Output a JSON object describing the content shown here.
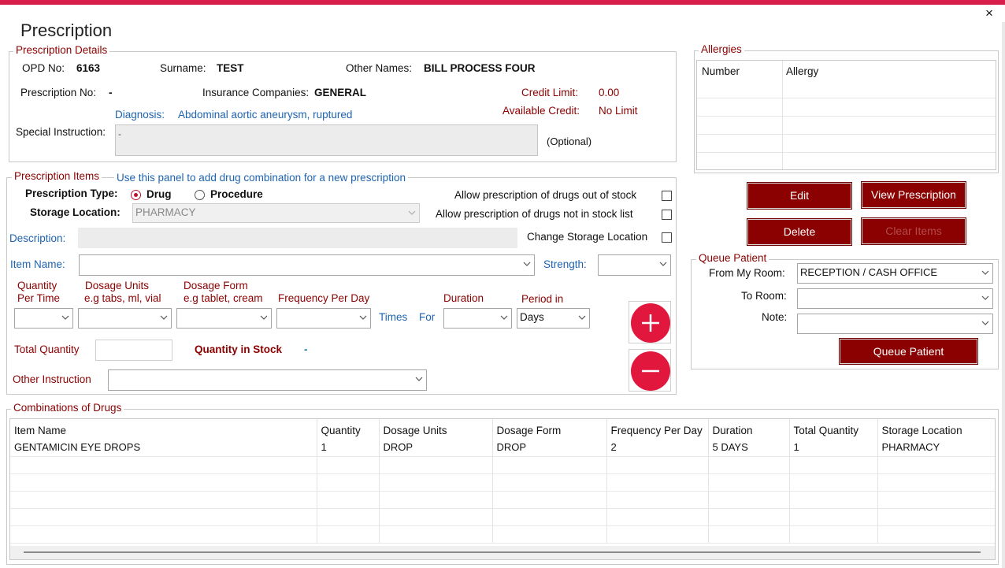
{
  "title": "Prescription",
  "close_icon": "×",
  "details": {
    "legend": "Prescription Details",
    "opd_label": "OPD No:",
    "opd_value": "6163",
    "surname_label": "Surname:",
    "surname_value": "TEST",
    "other_names_label": "Other Names:",
    "other_names_value": "BILL PROCESS FOUR",
    "prescription_no_label": "Prescription No:",
    "prescription_no_value": "-",
    "insurance_label": "Insurance Companies:",
    "insurance_value": "GENERAL",
    "credit_limit_label": "Credit Limit:",
    "credit_limit_value": "0.00",
    "available_credit_label": "Available Credit:",
    "available_credit_value": "No Limit",
    "diagnosis_label": "Diagnosis:",
    "diagnosis_value": "Abdominal aortic aneurysm, ruptured",
    "special_instruction_label": "Special Instruction:",
    "special_instruction_value": "-",
    "optional_label": "(Optional)"
  },
  "items": {
    "legend": "Prescription Items",
    "hint": "Use this panel to add drug combination for a new prescription",
    "type_label": "Prescription Type:",
    "type_drug": "Drug",
    "type_procedure": "Procedure",
    "storage_label": "Storage Location:",
    "storage_value": "PHARMACY",
    "allow_out_of_stock": "Allow prescription of drugs out of stock",
    "allow_not_in_list": "Allow prescription of drugs not in stock list",
    "change_storage": "Change Storage Location",
    "description_label": "Description:",
    "item_name_label": "Item Name:",
    "strength_label": "Strength:",
    "qty_per_time_l1": "Quantity",
    "qty_per_time_l2": "Per Time",
    "dosage_units_l1": "Dosage Units",
    "dosage_units_l2": "e.g tabs, ml, vial",
    "dosage_form_l1": "Dosage Form",
    "dosage_form_l2": "e.g tablet, cream",
    "frequency_label": "Frequency Per Day",
    "times_label": "Times",
    "for_label": "For",
    "duration_label": "Duration",
    "period_label": "Period in",
    "period_value": "Days",
    "total_qty_label": "Total Quantity",
    "qty_in_stock_label": "Quantity in Stock",
    "qty_in_stock_value": "-",
    "other_instruction_label": "Other Instruction"
  },
  "allergies": {
    "legend": "Allergies",
    "columns": [
      "Number",
      "Allergy"
    ]
  },
  "buttons": {
    "edit": "Edit",
    "view_prescription": "View Prescription",
    "delete": "Delete",
    "clear_items": "Clear Items",
    "queue_patient": "Queue Patient"
  },
  "queue": {
    "legend": "Queue Patient",
    "from_label": "From My Room:",
    "from_value": "RECEPTION / CASH OFFICE",
    "to_label": "To Room:",
    "note_label": "Note:"
  },
  "combinations": {
    "legend": "Combinations of Drugs",
    "columns": [
      "Item Name",
      "Quantity",
      "Dosage Units",
      "Dosage Form",
      "Frequency Per Day",
      "Duration",
      "Total Quantity",
      "Storage Location"
    ],
    "rows": [
      [
        "GENTAMICIN EYE DROPS",
        "1",
        "DROP",
        "DROP",
        "2",
        "5 DAYS",
        "1",
        "PHARMACY"
      ]
    ]
  },
  "colors": {
    "accent_bar": "#d81e4b",
    "button": "#8b0000",
    "label_red": "#8b0000",
    "label_blue": "#1e63b0",
    "add_remove": "#e2173e"
  }
}
